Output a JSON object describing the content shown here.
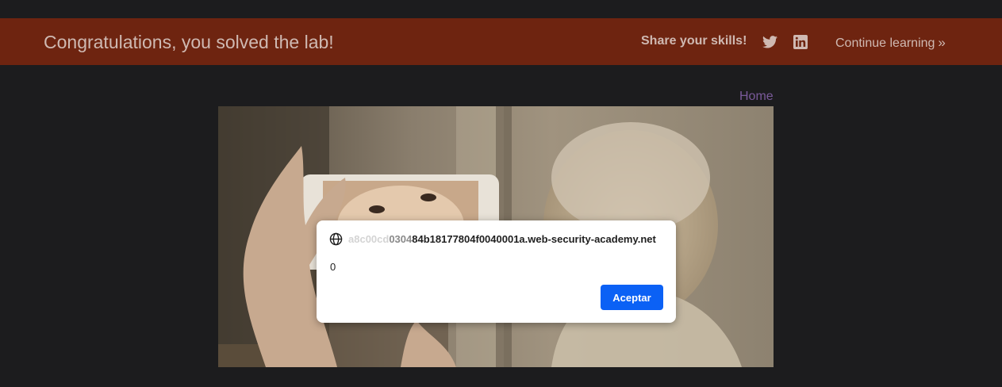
{
  "banner": {
    "title": "Congratulations, you solved the lab!",
    "share_label": "Share your skills!",
    "continue_label": "Continue learning",
    "continue_icon": "»",
    "background_color": "#6e2410"
  },
  "nav": {
    "home_label": "Home"
  },
  "alert_dialog": {
    "origin_faded": "a8c00cd",
    "origin_mid": "0304",
    "origin_main": "84b18177804f0040001a.web-security-academy.net",
    "message": "0",
    "ok_label": "Aceptar",
    "button_color": "#0b61f5"
  },
  "icons": {
    "twitter": "twitter-icon",
    "linkedin": "linkedin-icon",
    "globe": "globe-icon",
    "continue": "double-chevron-right-icon"
  }
}
